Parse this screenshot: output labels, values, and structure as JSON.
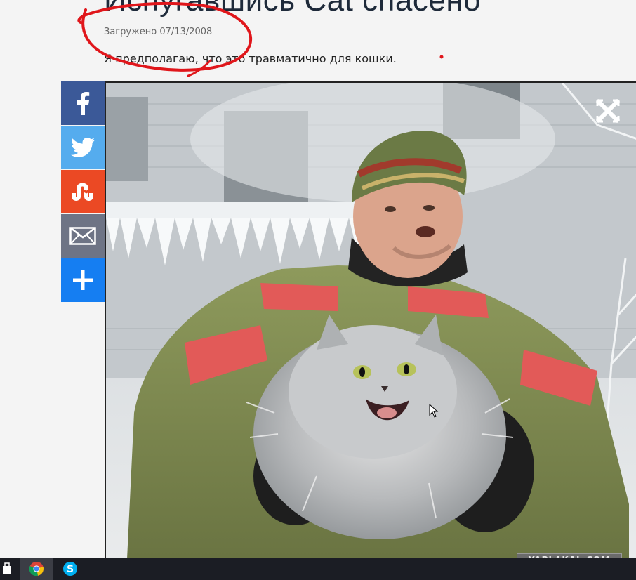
{
  "article": {
    "title": "Испугавшись Cat спасено",
    "uploaded": "Загружено 07/13/2008",
    "lead": "Я предполагаю, что это травматично для кошки."
  },
  "share": {
    "buttons": [
      {
        "name": "facebook",
        "color": "#3b5998"
      },
      {
        "name": "twitter",
        "color": "#55acee"
      },
      {
        "name": "stumbleupon",
        "color": "#eb4924"
      },
      {
        "name": "email",
        "color": "#6e7485"
      },
      {
        "name": "more",
        "color": "#157ef2"
      }
    ]
  },
  "photo": {
    "subject": "firefighter holding frightened cat"
  },
  "watermark": {
    "text": "YAPLAKAL.COM"
  },
  "annotation_color": "#e0161b",
  "taskbar": {
    "icons": [
      "store-icon",
      "chrome-icon",
      "skype-icon"
    ]
  }
}
